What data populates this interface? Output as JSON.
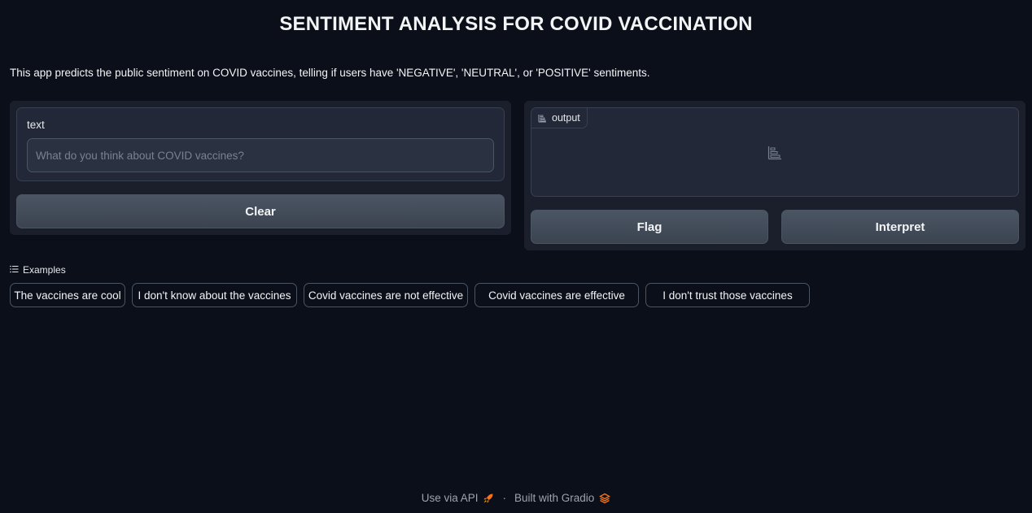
{
  "header": {
    "title": "SENTIMENT ANALYSIS FOR COVID VACCINATION",
    "description": "This app predicts the public sentiment on COVID vaccines, telling if users have 'NEGATIVE', 'NEUTRAL', or 'POSITIVE' sentiments."
  },
  "input": {
    "label": "text",
    "placeholder": "What do you think about COVID vaccines?",
    "value": ""
  },
  "buttons": {
    "clear": "Clear",
    "flag": "Flag",
    "interpret": "Interpret"
  },
  "output": {
    "label": "output",
    "icon": "bar-chart-icon"
  },
  "examples": {
    "header": "Examples",
    "items": [
      "The vaccines are cool",
      "I don't know about the vaccines",
      "Covid vaccines are not effective",
      "Covid vaccines are effective",
      "I don't trust those vaccines"
    ]
  },
  "footer": {
    "api_link": "Use via API",
    "separator": "·",
    "built_with": "Built with Gradio"
  },
  "colors": {
    "background": "#0b0f19",
    "panel": "#1a1f2b",
    "block": "#222837",
    "button": "#4b5563",
    "accent": "#f97316"
  }
}
